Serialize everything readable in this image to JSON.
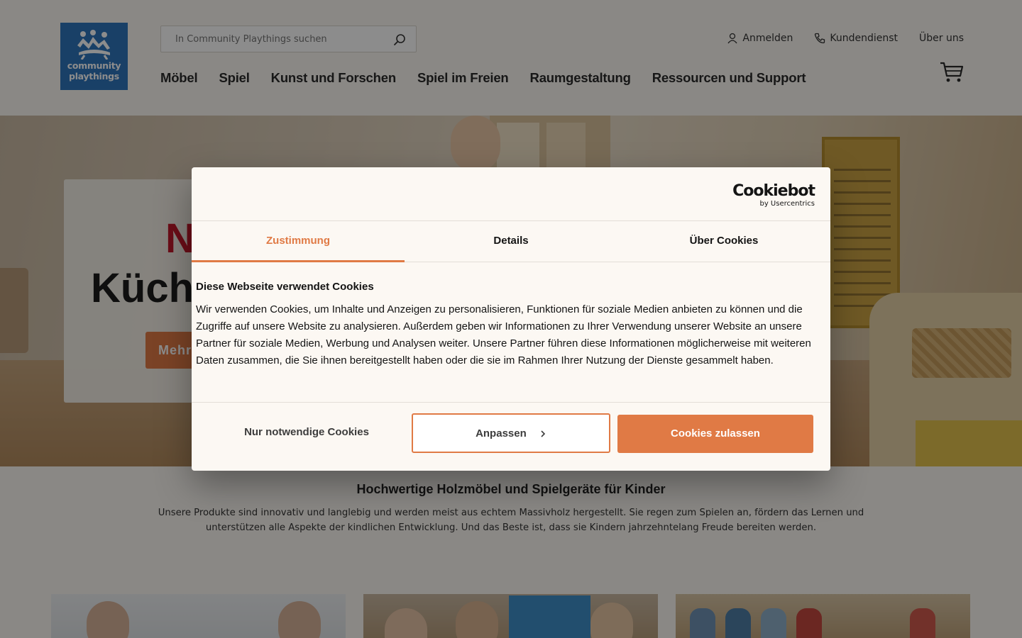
{
  "header": {
    "logo_line1": "community",
    "logo_line2": "playthings",
    "search_placeholder": "In Community Playthings suchen",
    "top_links": {
      "login": "Anmelden",
      "service": "Kundendienst",
      "about": "Über uns"
    },
    "main_nav": [
      "Möbel",
      "Spiel",
      "Kunst und Forschen",
      "Spiel im Freien",
      "Raumgestaltung",
      "Ressourcen und Support"
    ]
  },
  "hero": {
    "title_line1": "N",
    "title_line2": "Küche",
    "button": "Mehr"
  },
  "intro": {
    "title": "Hochwertige Holzmöbel und Spielgeräte für Kinder",
    "text": "Unsere Produkte sind innovativ und langlebig und werden meist aus echtem Massivholz hergestellt. Sie regen zum Spielen an, fördern das Lernen und unterstützen alle Aspekte der kindlichen Entwicklung. Und das Beste ist, dass sie Kindern jahrzehntelang Freude bereiten werden."
  },
  "cookie_dialog": {
    "brand": "Cookiebot",
    "brand_sub": "by Usercentrics",
    "tabs": [
      "Zustimmung",
      "Details",
      "Über Cookies"
    ],
    "active_tab": "Zustimmung",
    "heading": "Diese Webseite verwendet Cookies",
    "body": "Wir verwenden Cookies, um Inhalte und Anzeigen zu personalisieren, Funktionen für soziale Medien anbieten zu können und die Zugriffe auf unsere Website zu analysieren. Außerdem geben wir Informationen zu Ihrer Verwendung unserer Website an unsere Partner für soziale Medien, Werbung und Analysen weiter. Unsere Partner führen diese Informationen möglicherweise mit weiteren Daten zusammen, die Sie ihnen bereitgestellt haben oder die sie im Rahmen Ihrer Nutzung der Dienste gesammelt haben.",
    "buttons": {
      "necessary": "Nur notwendige Cookies",
      "customize": "Anpassen",
      "allow": "Cookies zulassen"
    }
  },
  "colors": {
    "accent": "#e07a45",
    "hero_red": "#c3182a",
    "logo_blue": "#2f76bc",
    "background": "#fbf8f3"
  },
  "icons": [
    "search-icon",
    "user-icon",
    "phone-icon",
    "cart-icon",
    "chevron-right-icon"
  ]
}
